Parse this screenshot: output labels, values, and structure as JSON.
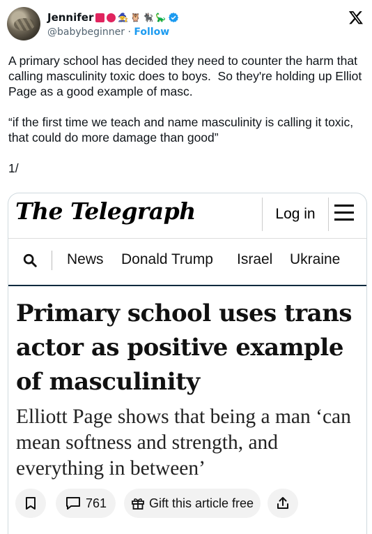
{
  "author": {
    "name": "Jennifer",
    "handle": "@babybeginner",
    "separator": "·",
    "follow_label": "Follow",
    "emoji": [
      "🧙",
      "🦉",
      "🐈‍⬛",
      "🦕"
    ]
  },
  "tweet": {
    "text": "A primary school has decided they need to counter the harm that calling masculinity toxic does to boys.  So they're holding up Elliot Page as a good example of masc.\n\n“if the first time we teach and name masculinity is calling it toxic, that could do more damage than good”\n\n1/"
  },
  "article": {
    "masthead": "The Telegraph",
    "login_label": "Log in",
    "nav": [
      "News",
      "Donald Trump",
      "Israel",
      "Ukraine"
    ],
    "headline": "Primary school uses trans actor as positive example of masculinity",
    "standfirst": "Elliott Page shows that being a man ‘can mean softness and strength, and everything in between’",
    "comment_count": "761",
    "gift_label": "Gift this article free"
  },
  "colors": {
    "accent": "#1d9bf0",
    "brand_red": "#e0245e",
    "nav_rule": "#0b2a3d"
  },
  "icons": [
    "avatar",
    "verified-badge-icon",
    "x-logo-icon",
    "menu-icon",
    "search-icon",
    "bookmark-icon",
    "comment-icon",
    "gift-icon",
    "share-icon"
  ]
}
